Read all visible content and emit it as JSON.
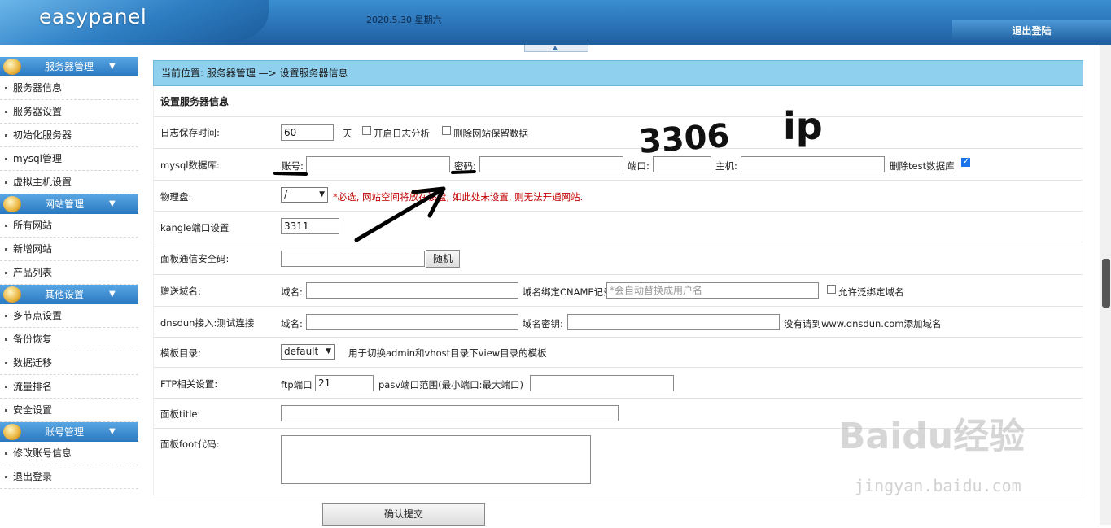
{
  "header": {
    "logo": "easypanel",
    "date": "2020.5.30 星期六",
    "logout": "退出登陆"
  },
  "sidebar": {
    "sections": [
      {
        "title": "服务器管理",
        "items": [
          "服务器信息",
          "服务器设置",
          "初始化服务器",
          "mysql管理",
          "虚拟主机设置"
        ]
      },
      {
        "title": "网站管理",
        "items": [
          "所有网站",
          "新增网站",
          "产品列表"
        ]
      },
      {
        "title": "其他设置",
        "items": [
          "多节点设置",
          "备份恢复",
          "数据迁移",
          "流量排名",
          "安全设置"
        ]
      },
      {
        "title": "账号管理",
        "items": [
          "修改账号信息",
          "退出登录"
        ]
      }
    ],
    "arrow": "▼"
  },
  "main": {
    "breadcrumb": "当前位置: 服务器管理 —> 设置服务器信息",
    "section_title": "设置服务器信息",
    "log": {
      "label": "日志保存时间:",
      "value": "60",
      "unit": "天",
      "analyze": "开启日志分析",
      "delete_data": "删除网站保留数据"
    },
    "mysql": {
      "label": "mysql数据库:",
      "account": "账号:",
      "password": "密码:",
      "port": "端口:",
      "host": "主机:",
      "delete_test": "删除test数据库"
    },
    "disk": {
      "label": "物理盘:",
      "value": "/",
      "note": "*必选, 网站空间将放在该盘, 如此处未设置, 则无法开通网站."
    },
    "kangle": {
      "label": "kangle端口设置",
      "value": "3311"
    },
    "secure": {
      "label": "面板通信安全码:",
      "random": "随机"
    },
    "gift": {
      "label": "赠送域名:",
      "domain": "域名:",
      "cname": "域名绑定CNAME记录",
      "cname_placeholder": "*会自动替换成用户名",
      "wildcard": "允许泛绑定域名"
    },
    "dnsdun": {
      "label": "dnsdun接入:测试连接",
      "domain": "域名:",
      "key": "域名密钥:",
      "note": "没有请到www.dnsdun.com添加域名"
    },
    "template": {
      "label": "模板目录:",
      "value": "default",
      "note": "用于切换admin和vhost目录下view目录的模板"
    },
    "ftp": {
      "label": "FTP相关设置:",
      "port": "ftp端口",
      "port_value": "21",
      "pasv": "pasv端口范围(最小端口:最大端口)"
    },
    "title": {
      "label": "面板title:"
    },
    "foot": {
      "label": "面板foot代码:"
    },
    "submit": "确认提交"
  },
  "annotations": {
    "port_note": "3306",
    "host_note": "ip"
  },
  "watermark": {
    "text": "Baidu经验",
    "url": "jingyan.baidu.com"
  }
}
